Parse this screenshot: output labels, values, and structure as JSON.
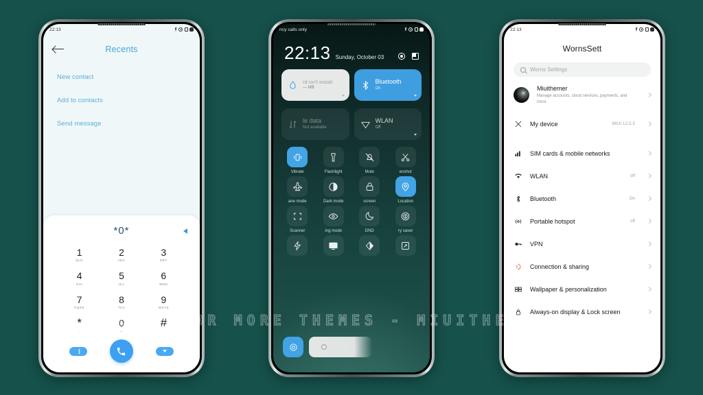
{
  "watermark": "VISIT FOR MORE THEMES - MIUITHEMER.COM",
  "phone1": {
    "statusbar": {
      "time": "22:13"
    },
    "header": {
      "title": "Recents"
    },
    "menu_items": [
      {
        "label": "New contact"
      },
      {
        "label": "Add to contacts"
      },
      {
        "label": "Send message"
      }
    ],
    "dialer": {
      "display": "*0*",
      "keys": [
        {
          "digit": "1",
          "letters": "QLD"
        },
        {
          "digit": "2",
          "letters": "ABC"
        },
        {
          "digit": "3",
          "letters": "DEF"
        },
        {
          "digit": "4",
          "letters": "GHI"
        },
        {
          "digit": "5",
          "letters": "JKL"
        },
        {
          "digit": "6",
          "letters": "MNO"
        },
        {
          "digit": "7",
          "letters": "PQRS"
        },
        {
          "digit": "8",
          "letters": "TUV"
        },
        {
          "digit": "9",
          "letters": "WXYZ"
        },
        {
          "digit": "*",
          "letters": ","
        },
        {
          "digit": "0",
          "letters": "+"
        },
        {
          "digit": "#",
          "letters": ""
        }
      ]
    }
  },
  "phone2": {
    "statusbar": {
      "carrier": "ncy calls only"
    },
    "clock": {
      "time": "22:13",
      "date": "Sunday, October 03"
    },
    "big_tiles": [
      {
        "title": "rd isn't install",
        "subtitle": "— MB",
        "state": "light",
        "icon": "water-drop-icon"
      },
      {
        "title": "Bluetooth",
        "subtitle": "On",
        "state": "on",
        "icon": "bluetooth-icon"
      },
      {
        "title": "le data",
        "subtitle": "Not available",
        "state": "off",
        "icon": "mobile-data-icon"
      },
      {
        "title": "WLAN",
        "subtitle": "Off",
        "state": "dim",
        "icon": "wlan-icon"
      }
    ],
    "quick_tiles": [
      {
        "label": "Vibrate",
        "icon": "vibrate-icon",
        "on": true
      },
      {
        "label": "Flashlight",
        "icon": "flashlight-icon",
        "on": false
      },
      {
        "label": "Mute",
        "icon": "mute-icon",
        "on": false
      },
      {
        "label": "enshot",
        "icon": "screenshot-icon",
        "on": false
      },
      {
        "label": "ane mode",
        "icon": "airplane-mode-icon",
        "on": false
      },
      {
        "label": "Dark mode",
        "icon": "dark-mode-icon",
        "on": false
      },
      {
        "label": "screen",
        "icon": "lock-screen-icon",
        "on": false
      },
      {
        "label": "Location",
        "icon": "location-icon",
        "on": true
      },
      {
        "label": "Scanner",
        "icon": "scanner-icon",
        "on": false
      },
      {
        "label": "ing mode",
        "icon": "reading-mode-icon",
        "on": false
      },
      {
        "label": "DND",
        "icon": "dnd-icon",
        "on": false
      },
      {
        "label": "ry saver",
        "icon": "battery-saver-icon",
        "on": false
      },
      {
        "label": "",
        "icon": "lightning-icon",
        "on": false
      },
      {
        "label": "",
        "icon": "cast-icon",
        "on": false
      },
      {
        "label": "",
        "icon": "contrast-icon",
        "on": false
      },
      {
        "label": "",
        "icon": "expand-icon",
        "on": false
      }
    ]
  },
  "phone3": {
    "statusbar": {
      "time": "22:13"
    },
    "title": "WornsSett",
    "search": {
      "placeholder": "Worns Settings"
    },
    "account": {
      "name": "Miuithemer",
      "subtitle": "Manage accounts, cloud services, payments, and more"
    },
    "rows": [
      {
        "label": "My device",
        "value": "MIUI 12.5.5",
        "icon": "device-icon"
      },
      {
        "label": "SIM cards & mobile networks",
        "value": "",
        "icon": "sim-icon"
      },
      {
        "label": "WLAN",
        "value": "off",
        "icon": "wifi-icon"
      },
      {
        "label": "Bluetooth",
        "value": "On",
        "icon": "bluetooth-icon"
      },
      {
        "label": "Portable hotspot",
        "value": "off",
        "icon": "hotspot-icon"
      },
      {
        "label": "VPN",
        "value": "",
        "icon": "vpn-key-icon"
      },
      {
        "label": "Connection & sharing",
        "value": "",
        "icon": "connection-sharing-icon"
      },
      {
        "label": "Wallpaper & personalization",
        "value": "",
        "icon": "wallpaper-icon"
      },
      {
        "label": "Always-on display & Lock screen",
        "value": "",
        "icon": "lock-icon"
      }
    ]
  }
}
